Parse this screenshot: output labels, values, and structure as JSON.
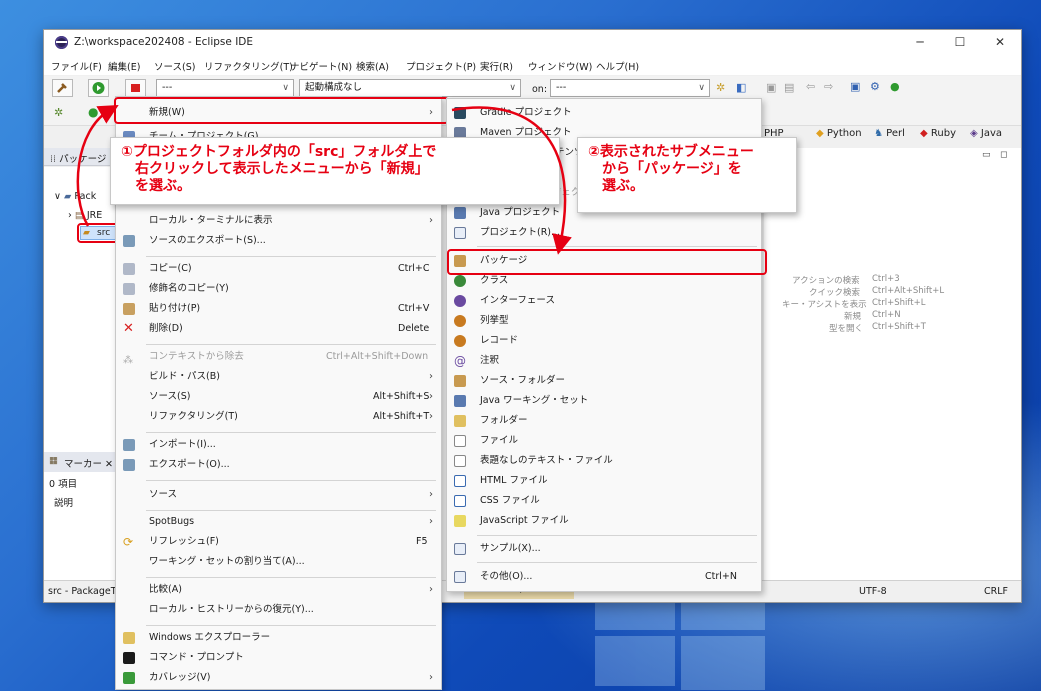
{
  "window": {
    "title": "Z:\\workspace202408 - Eclipse IDE",
    "controls": [
      "─",
      "☐",
      "✕"
    ]
  },
  "menubar": [
    "ファイル(F)",
    "編集(E)",
    "ソース(S)",
    "リファクタリング(T)",
    "ナビゲート(N)",
    "検索(A)",
    "プロジェクト(P)",
    "実行(R)",
    "ウィンドウ(W)",
    "ヘルプ(H)"
  ],
  "toolbar": {
    "combo1": "---",
    "combo2": "起動構成なし",
    "on_label": "on:",
    "combo3": "---"
  },
  "perspectives": [
    "PHP",
    "Python",
    "Perl",
    "Ruby",
    "Java"
  ],
  "left": {
    "package_tab": "パッケージ",
    "tree": [
      "Pack",
      "JRE",
      "src"
    ],
    "marker_tab": "マーカー",
    "marker_count": "0 項目",
    "marker_column": "説明",
    "status_text": "src - PackageT"
  },
  "editor_hints": [
    {
      "label": "アクションの検索",
      "key": "Ctrl+3"
    },
    {
      "label": "クイック検索",
      "key": "Ctrl+Alt+Shift+L"
    },
    {
      "label": "キー・アシストを表示",
      "key": "Ctrl+Shift+L"
    },
    {
      "label": "新規",
      "key": "Ctrl+N"
    },
    {
      "label": "型を開く",
      "key": "Ctrl+Shift+T"
    }
  ],
  "statusbar": {
    "memory": "746M / 2855M",
    "encoding": "UTF-8",
    "line_ending": "CRLF"
  },
  "context_menu": {
    "items": [
      {
        "label": "新規(W)",
        "shortcut": "",
        "submenu": true
      },
      {
        "label": "ローカル・ターミナルに表示",
        "shortcut": "",
        "submenu": true
      },
      {
        "label": "ソースのエクスポート(S)...",
        "shortcut": ""
      },
      {
        "label": "コピー(C)",
        "shortcut": "Ctrl+C"
      },
      {
        "label": "修飾名のコピー(Y)",
        "shortcut": ""
      },
      {
        "label": "貼り付け(P)",
        "shortcut": "Ctrl+V"
      },
      {
        "label": "削除(D)",
        "shortcut": "Delete"
      },
      {
        "label": "コンテキストから除去",
        "shortcut": "Ctrl+Alt+Shift+Down",
        "disabled": true
      },
      {
        "label": "ビルド・パス(B)",
        "shortcut": "",
        "submenu": true
      },
      {
        "label": "ソース(S)",
        "shortcut": "Alt+Shift+S",
        "submenu": true
      },
      {
        "label": "リファクタリング(T)",
        "shortcut": "Alt+Shift+T",
        "submenu": true
      },
      {
        "label": "インポート(I)...",
        "shortcut": ""
      },
      {
        "label": "エクスポート(O)...",
        "shortcut": ""
      },
      {
        "label": "ソース",
        "shortcut": "",
        "submenu": true
      },
      {
        "label": "SpotBugs",
        "shortcut": "",
        "submenu": true
      },
      {
        "label": "リフレッシュ(F)",
        "shortcut": "F5"
      },
      {
        "label": "ワーキング・セットの割り当て(A)...",
        "shortcut": ""
      },
      {
        "label": "比較(A)",
        "shortcut": "",
        "submenu": true
      },
      {
        "label": "ローカル・ヒストリーからの復元(Y)...",
        "shortcut": ""
      },
      {
        "label": "Windows エクスプローラー",
        "shortcut": ""
      },
      {
        "label": "コマンド・プロンプト",
        "shortcut": ""
      },
      {
        "label": "カバレッジ(V)",
        "shortcut": "",
        "submenu": true
      }
    ],
    "hidden_partial": [
      "チーム・プロジェクト(G)",
      "Alt+Shift+W ›"
    ]
  },
  "submenu": {
    "items": [
      {
        "label": "Gradle プロジェクト"
      },
      {
        "label": "Maven プロジェクト"
      },
      {
        "label": "入門コンテンツ"
      },
      {
        "label": "動的 Web プロジェクト"
      },
      {
        "label": "Java プロジェクト"
      },
      {
        "label": "プロジェクト(R)..."
      },
      {
        "label": "パッケージ"
      },
      {
        "label": "クラス"
      },
      {
        "label": "インターフェース"
      },
      {
        "label": "列挙型"
      },
      {
        "label": "レコード"
      },
      {
        "label": "注釈"
      },
      {
        "label": "ソース・フォルダー"
      },
      {
        "label": "Java ワーキング・セット"
      },
      {
        "label": "フォルダー"
      },
      {
        "label": "ファイル"
      },
      {
        "label": "表題なしのテキスト・ファイル"
      },
      {
        "label": "HTML ファイル"
      },
      {
        "label": "CSS ファイル"
      },
      {
        "label": "JavaScript ファイル"
      },
      {
        "label": "サンプル(X)..."
      },
      {
        "label": "その他(O)...",
        "shortcut": "Ctrl+N"
      }
    ]
  },
  "annotations": {
    "callout1": [
      "①プロジェクトフォルダ内の「src」フォルダ上で",
      "右クリックして表示したメニューから「新規」",
      "を選ぶ。"
    ],
    "callout2": [
      "②表示されたサブメニュー",
      "から「パッケージ」を",
      "選ぶ。"
    ]
  }
}
